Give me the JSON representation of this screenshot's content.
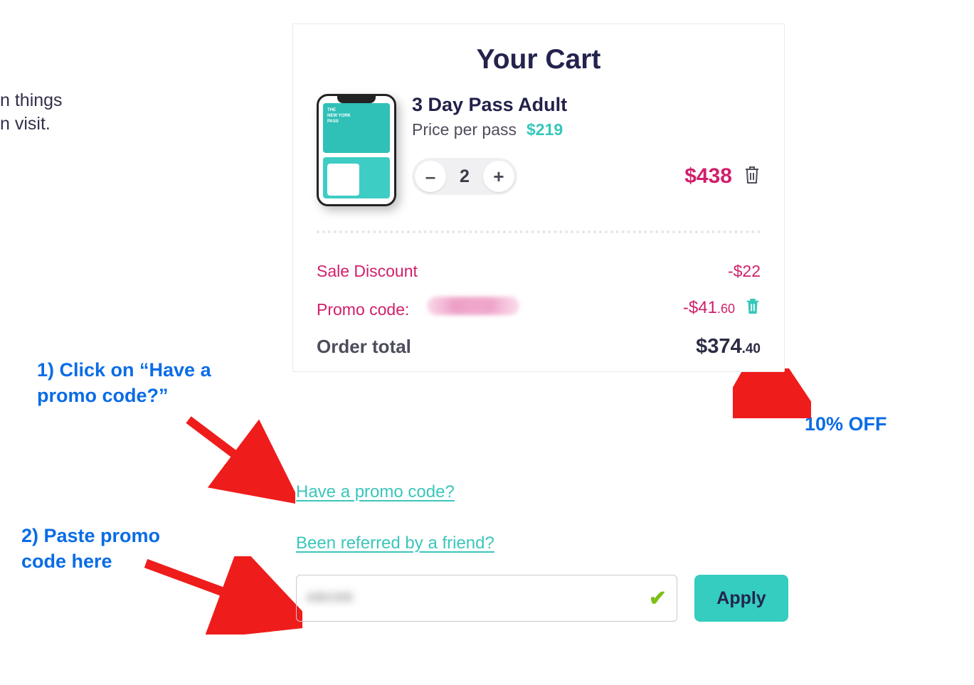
{
  "left_clipped": {
    "line1": "n things",
    "line2": "n visit."
  },
  "annotations": {
    "step1": "1) Click on “Have a\npromo code?”",
    "step2": "2) Paste promo\ncode here",
    "discount_label": "10% OFF"
  },
  "cart": {
    "title": "Your Cart",
    "item": {
      "name": "3 Day Pass Adult",
      "price_per_label": "Price per pass",
      "price_per_value": "$219",
      "quantity": "2",
      "line_total": "$438"
    },
    "pass_card": {
      "line1": "THE",
      "line2": "NEW YORK",
      "line3": "PASS"
    },
    "sale_discount": {
      "label": "Sale Discount",
      "value": "-$22"
    },
    "promo_code": {
      "label": "Promo code:",
      "value_main": "-$41",
      "value_cents": ".60"
    },
    "order_total": {
      "label": "Order total",
      "value_main": "$374",
      "value_cents": ".40"
    }
  },
  "links": {
    "have_promo": "Have a promo code?",
    "referred": "Been referred by a friend?"
  },
  "apply": {
    "button_label": "Apply"
  }
}
